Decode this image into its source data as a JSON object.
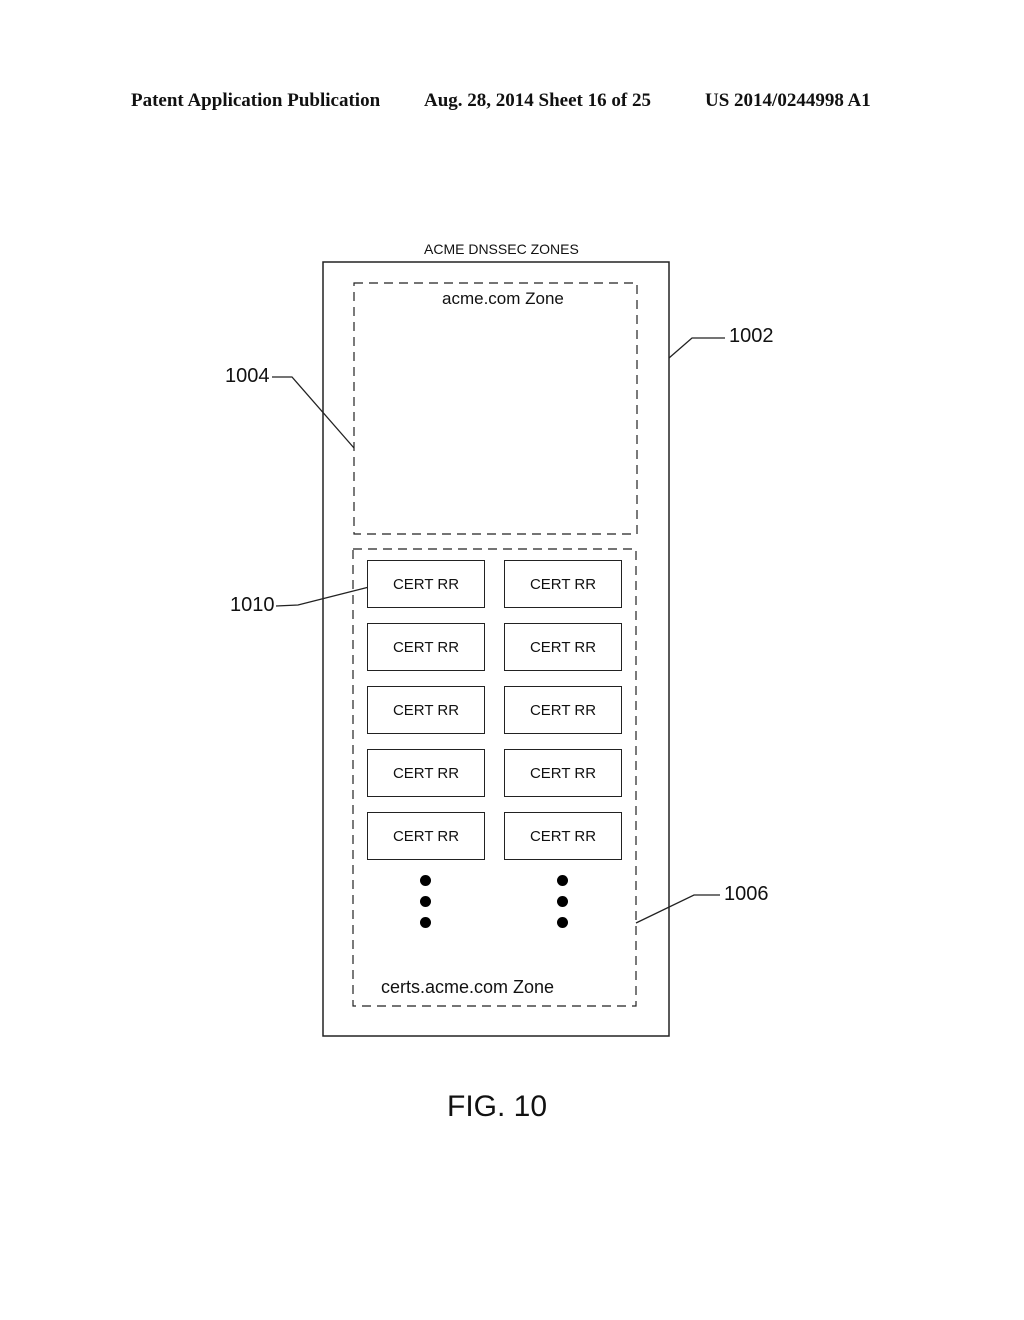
{
  "header": {
    "publication": "Patent Application Publication",
    "date_sheet": "Aug. 28, 2014  Sheet 16 of 25",
    "number": "US 2014/0244998 A1"
  },
  "diagram": {
    "title": "ACME DNSSEC ZONES",
    "zone_top_label": "acme.com Zone",
    "zone_bottom_label": "certs.acme.com Zone",
    "cert_label": "CERT RR",
    "refs": {
      "outer": "1002",
      "top_zone": "1004",
      "bottom_zone": "1006",
      "cert": "1010"
    },
    "cert_rows": 5,
    "cert_cols": 2
  },
  "figure_label": "FIG. 10"
}
